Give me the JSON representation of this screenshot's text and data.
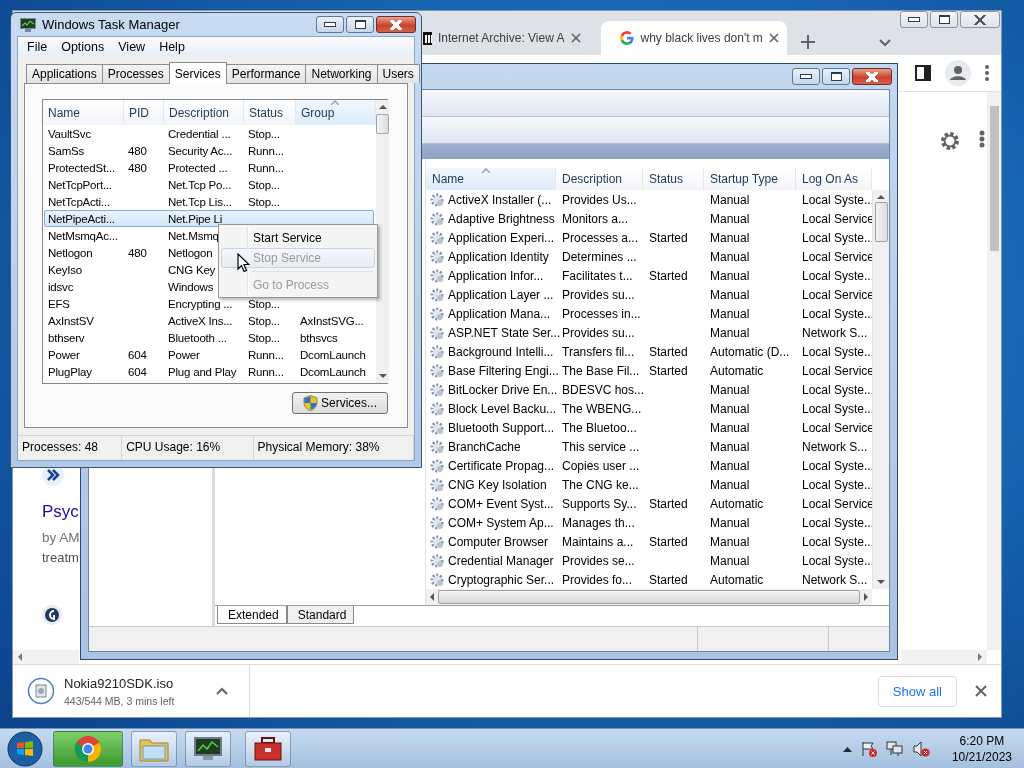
{
  "browser": {
    "tabs": [
      {
        "title": "Internet Archive: View A",
        "selected": false
      },
      {
        "title": "why black lives don't m",
        "selected": true
      }
    ],
    "page": {
      "link": "Psyc",
      "byline": "by AM",
      "snippet": "treatm"
    },
    "download": {
      "filename": "Nokia9210SDK.iso",
      "progress": "443/544 MB, 3 mins left",
      "show_all": "Show all"
    }
  },
  "services_console": {
    "columns": [
      "Name",
      "Description",
      "Status",
      "Startup Type",
      "Log On As"
    ],
    "rows": [
      {
        "name": "ActiveX Installer (...",
        "description": "Provides Us...",
        "startup_type": "Manual",
        "log_on_as": "Local Syste..."
      },
      {
        "name": "Adaptive Brightness",
        "description": "Monitors a...",
        "startup_type": "Manual",
        "log_on_as": "Local Service"
      },
      {
        "name": "Application Experi...",
        "description": "Processes a...",
        "status": "Started",
        "startup_type": "Manual",
        "log_on_as": "Local Syste..."
      },
      {
        "name": "Application Identity",
        "description": "Determines ...",
        "startup_type": "Manual",
        "log_on_as": "Local Service"
      },
      {
        "name": "Application Infor...",
        "description": "Facilitates t...",
        "status": "Started",
        "startup_type": "Manual",
        "log_on_as": "Local Syste..."
      },
      {
        "name": "Application Layer ...",
        "description": "Provides su...",
        "startup_type": "Manual",
        "log_on_as": "Local Service"
      },
      {
        "name": "Application Mana...",
        "description": "Processes in...",
        "startup_type": "Manual",
        "log_on_as": "Local Syste..."
      },
      {
        "name": "ASP.NET State Ser...",
        "description": "Provides su...",
        "startup_type": "Manual",
        "log_on_as": "Network S..."
      },
      {
        "name": "Background Intelli...",
        "description": "Transfers fil...",
        "status": "Started",
        "startup_type": "Automatic (D...",
        "log_on_as": "Local Syste..."
      },
      {
        "name": "Base Filtering Engi...",
        "description": "The Base Fil...",
        "status": "Started",
        "startup_type": "Automatic",
        "log_on_as": "Local Service"
      },
      {
        "name": "BitLocker Drive En...",
        "description": "BDESVC hos...",
        "startup_type": "Manual",
        "log_on_as": "Local Syste..."
      },
      {
        "name": "Block Level Backu...",
        "description": "The WBENG...",
        "startup_type": "Manual",
        "log_on_as": "Local Syste..."
      },
      {
        "name": "Bluetooth Support...",
        "description": "The Bluetoo...",
        "startup_type": "Manual",
        "log_on_as": "Local Service"
      },
      {
        "name": "BranchCache",
        "description": "This service ...",
        "startup_type": "Manual",
        "log_on_as": "Network S..."
      },
      {
        "name": "Certificate Propag...",
        "description": "Copies user ...",
        "startup_type": "Manual",
        "log_on_as": "Local Syste..."
      },
      {
        "name": "CNG Key Isolation",
        "description": "The CNG ke...",
        "startup_type": "Manual",
        "log_on_as": "Local Syste..."
      },
      {
        "name": "COM+ Event Syst...",
        "description": "Supports Sy...",
        "status": "Started",
        "startup_type": "Automatic",
        "log_on_as": "Local Service"
      },
      {
        "name": "COM+ System Ap...",
        "description": "Manages th...",
        "startup_type": "Manual",
        "log_on_as": "Local Syste..."
      },
      {
        "name": "Computer Browser",
        "description": "Maintains a...",
        "status": "Started",
        "startup_type": "Manual",
        "log_on_as": "Local Syste..."
      },
      {
        "name": "Credential Manager",
        "description": "Provides se...",
        "startup_type": "Manual",
        "log_on_as": "Local Syste..."
      },
      {
        "name": "Cryptographic Ser...",
        "description": "Provides fo...",
        "status": "Started",
        "startup_type": "Automatic",
        "log_on_as": "Network S..."
      }
    ],
    "view_tabs": [
      {
        "label": "Extended",
        "selected": true
      },
      {
        "label": "Standard",
        "selected": false
      }
    ]
  },
  "task_manager": {
    "title": "Windows Task Manager",
    "menu": [
      "File",
      "Options",
      "View",
      "Help"
    ],
    "tabs": [
      {
        "label": "Applications",
        "selected": false
      },
      {
        "label": "Processes",
        "selected": false
      },
      {
        "label": "Services",
        "selected": true
      },
      {
        "label": "Performance",
        "selected": false
      },
      {
        "label": "Networking",
        "selected": false
      },
      {
        "label": "Users",
        "selected": false
      }
    ],
    "columns": [
      "Name",
      "PID",
      "Description",
      "Status",
      "Group"
    ],
    "rows": [
      {
        "name": "VaultSvc",
        "description": "Credential ...",
        "status": "Stop...",
        "selected": false
      },
      {
        "name": "SamSs",
        "pid": "480",
        "description": "Security Ac...",
        "status": "Runn...",
        "selected": false
      },
      {
        "name": "ProtectedSt...",
        "pid": "480",
        "description": "Protected ...",
        "status": "Runn...",
        "selected": false
      },
      {
        "name": "NetTcpPort...",
        "description": "Net.Tcp Po...",
        "status": "Stop...",
        "selected": false
      },
      {
        "name": "NetTcpActi...",
        "description": "Net.Tcp Lis...",
        "status": "Stop...",
        "selected": false
      },
      {
        "name": "NetPipeActi...",
        "description": "Net.Pipe Li",
        "selected": true
      },
      {
        "name": "NetMsmqAc...",
        "description": "Net.Msmq",
        "selected": false
      },
      {
        "name": "Netlogon",
        "pid": "480",
        "description": "Netlogon",
        "selected": false
      },
      {
        "name": "KeyIso",
        "description": "CNG Key",
        "selected": false
      },
      {
        "name": "idsvc",
        "description": "Windows",
        "selected": false
      },
      {
        "name": "EFS",
        "description": "Encrypting ...",
        "status": "Stop...",
        "selected": false
      },
      {
        "name": "AxInstSV",
        "description": "ActiveX Ins...",
        "status": "Stop...",
        "group": "AxInstSVG...",
        "selected": false
      },
      {
        "name": "bthserv",
        "description": "Bluetooth ...",
        "status": "Stop...",
        "group": "bthsvcs",
        "selected": false
      },
      {
        "name": "Power",
        "pid": "604",
        "description": "Power",
        "status": "Runn...",
        "group": "DcomLaunch",
        "selected": false
      },
      {
        "name": "PlugPlay",
        "pid": "604",
        "description": "Plug and Play",
        "status": "Runn...",
        "group": "DcomLaunch",
        "selected": false
      }
    ],
    "context_menu": [
      {
        "kind": "item",
        "label": "Start Service",
        "disabled": false,
        "highlighted": false
      },
      {
        "kind": "item",
        "label": "Stop Service",
        "disabled": true,
        "highlighted": true
      },
      {
        "kind": "separator"
      },
      {
        "kind": "item",
        "label": "Go to Process",
        "disabled": true,
        "highlighted": false
      }
    ],
    "services_button": "Services...",
    "status_bar": [
      "Processes: 48",
      "CPU Usage: 16%",
      "Physical Memory: 38%"
    ]
  },
  "taskbar": {
    "time": "6:20 PM",
    "date": "10/21/2023"
  }
}
